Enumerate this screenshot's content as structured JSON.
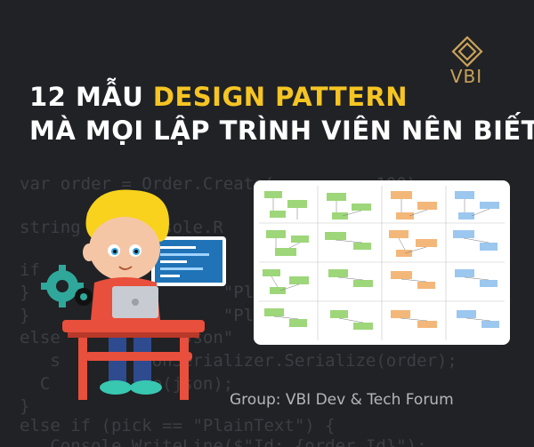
{
  "brand": {
    "logo_text": "VBI",
    "logo_color": "#c9a15a"
  },
  "title": {
    "line1_prefix": "12 MẪU ",
    "line1_highlight": "DESIGN PATTERN",
    "line2": "MÀ MỌI LẬP TRÌNH VIÊN NÊN BIẾT",
    "highlight_color": "#f6c523"
  },
  "footer": {
    "group_label": "Group: VBI Dev & Tech Forum"
  },
  "code_background": {
    "lines": [
      "var order = Order.Create(          100);",
      "string     Console.R",
      "if                  ",
      "}                   \"Pl",
      "else  (        \"Json\"",
      "   s        sonSerializer.Serialize(order);",
      "  C          e(json);",
      "}",
      "else if (pick == \"PlainText\") {",
      "   Console.WriteLine($\"Id: {order.Id}\");"
    ]
  },
  "colors": {
    "background": "#202225",
    "code_text": "#3b3e43",
    "title_text": "#ffffff"
  }
}
